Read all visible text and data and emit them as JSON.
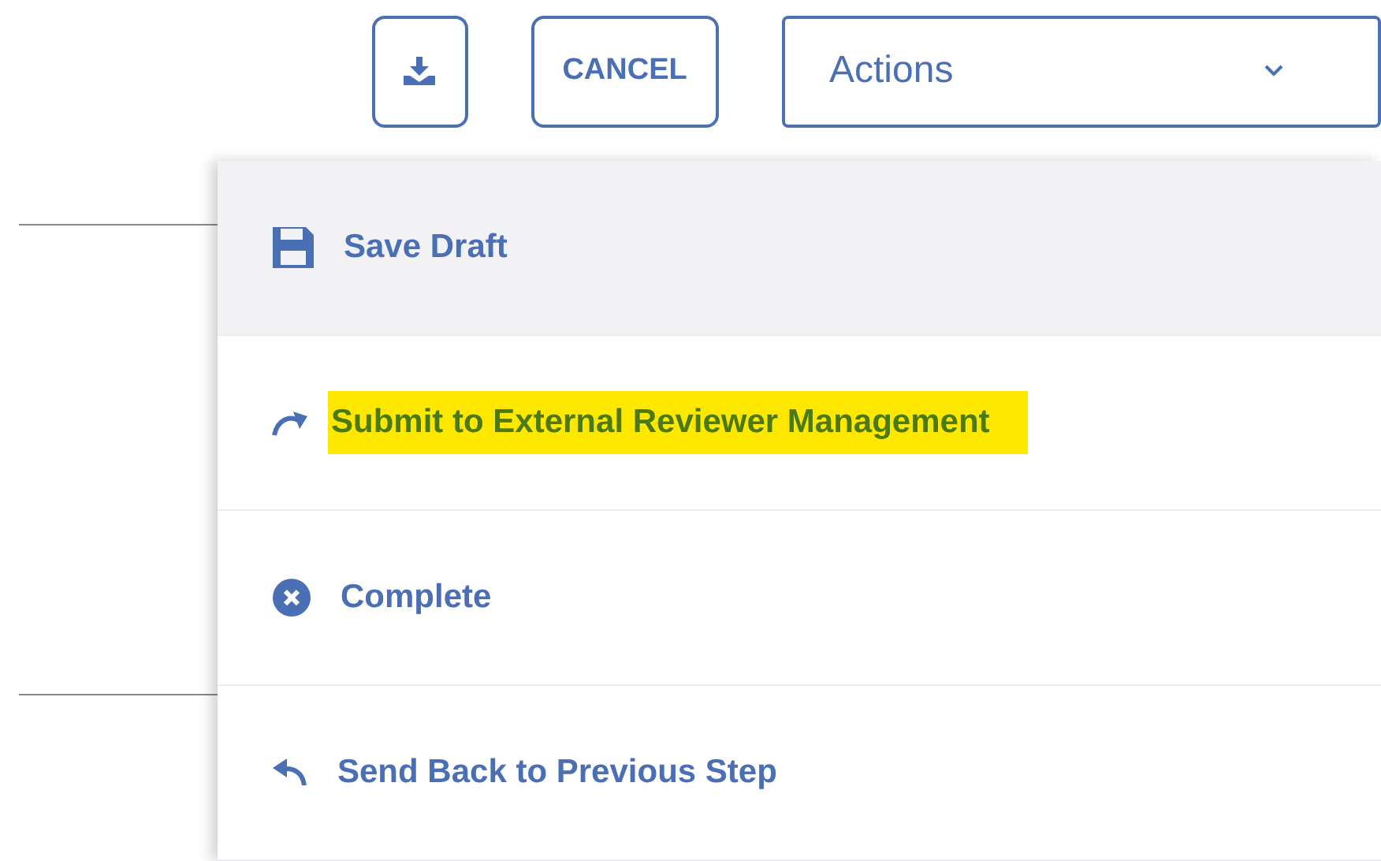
{
  "toolbar": {
    "cancel_button": {
      "label": "CANCEL"
    },
    "actions_select": {
      "value": "Actions"
    }
  },
  "menu": {
    "items": [
      {
        "kind": "save",
        "label": "Save Draft",
        "hovered": true,
        "highlighted": false
      },
      {
        "kind": "submit",
        "label": "Submit to External Reviewer Management",
        "hovered": false,
        "highlighted": true
      },
      {
        "kind": "complete",
        "label": "Complete",
        "hovered": false,
        "highlighted": false
      },
      {
        "kind": "back",
        "label": "Send Back to Previous Step",
        "hovered": false,
        "highlighted": false
      }
    ]
  }
}
